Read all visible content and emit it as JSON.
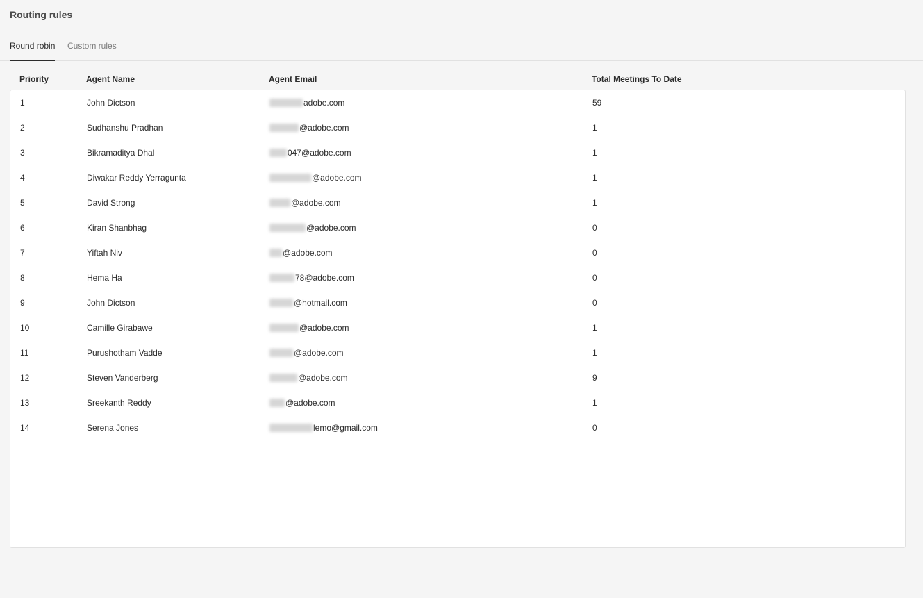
{
  "page": {
    "title": "Routing rules"
  },
  "tabs": [
    {
      "label": "Round robin",
      "active": true
    },
    {
      "label": "Custom rules",
      "active": false
    }
  ],
  "table": {
    "columns": {
      "priority": "Priority",
      "agent_name": "Agent Name",
      "agent_email": "Agent Email",
      "total_meetings": "Total Meetings To Date"
    },
    "rows": [
      {
        "priority": "1",
        "name": "John Dictson",
        "email_visible": "adobe.com",
        "total": "59"
      },
      {
        "priority": "2",
        "name": "Sudhanshu Pradhan",
        "email_visible": "@adobe.com",
        "total": "1"
      },
      {
        "priority": "3",
        "name": "Bikramaditya Dhal",
        "email_visible": "047@adobe.com",
        "total": "1"
      },
      {
        "priority": "4",
        "name": "Diwakar Reddy Yerragunta",
        "email_visible": "@adobe.com",
        "total": "1"
      },
      {
        "priority": "5",
        "name": "David Strong",
        "email_visible": "@adobe.com",
        "total": "1"
      },
      {
        "priority": "6",
        "name": "Kiran Shanbhag",
        "email_visible": "@adobe.com",
        "total": "0"
      },
      {
        "priority": "7",
        "name": "Yiftah Niv",
        "email_visible": "@adobe.com",
        "total": "0"
      },
      {
        "priority": "8",
        "name": "Hema Ha",
        "email_visible": "78@adobe.com",
        "total": "0"
      },
      {
        "priority": "9",
        "name": "John Dictson",
        "email_visible": "@hotmail.com",
        "total": "0"
      },
      {
        "priority": "10",
        "name": "Camille Girabawe",
        "email_visible": "@adobe.com",
        "total": "1"
      },
      {
        "priority": "11",
        "name": "Purushotham Vadde",
        "email_visible": "@adobe.com",
        "total": "1"
      },
      {
        "priority": "12",
        "name": "Steven Vanderberg",
        "email_visible": "@adobe.com",
        "total": "9"
      },
      {
        "priority": "13",
        "name": "Sreekanth Reddy",
        "email_visible": "@adobe.com",
        "total": "1"
      },
      {
        "priority": "14",
        "name": "Serena Jones",
        "email_visible": "lemo@gmail.com",
        "total": "0"
      }
    ]
  }
}
